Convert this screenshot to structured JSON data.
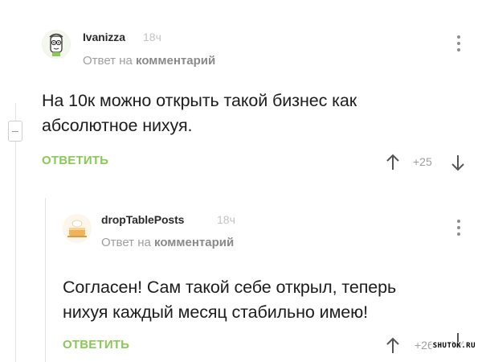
{
  "comments": [
    {
      "username": "Ivanizza",
      "time": "18ч",
      "reply_prefix": "Ответ на",
      "reply_target": "комментарий",
      "text_lines": [
        "На 10к можно открыть такой бизнес как",
        "абсолютное нихуя."
      ],
      "reply_label": "ОТВЕТИТЬ",
      "rating": "+25"
    },
    {
      "username": "dropTablePosts",
      "time": "18ч",
      "reply_prefix": "Ответ на",
      "reply_target": "комментарий",
      "text_lines": [
        "Согласен! Сам такой себе открыл, теперь",
        "нихуя каждый месяц стабильно имею!"
      ],
      "reply_label": "ОТВЕТИТЬ",
      "rating": "+26"
    }
  ],
  "watermark": "SHUTOK.RU",
  "colors": {
    "accent_green": "#8ac858",
    "meta_gray": "#9e9e9e",
    "text": "#1c1c1c"
  }
}
